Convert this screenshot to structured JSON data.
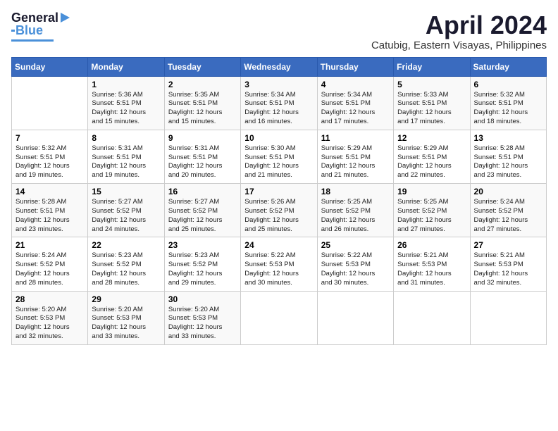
{
  "logo": {
    "line1": "General",
    "line2": "Blue"
  },
  "header": {
    "title": "April 2024",
    "location": "Catubig, Eastern Visayas, Philippines"
  },
  "weekdays": [
    "Sunday",
    "Monday",
    "Tuesday",
    "Wednesday",
    "Thursday",
    "Friday",
    "Saturday"
  ],
  "weeks": [
    [
      {
        "day": "",
        "content": ""
      },
      {
        "day": "1",
        "content": "Sunrise: 5:36 AM\nSunset: 5:51 PM\nDaylight: 12 hours\nand 15 minutes."
      },
      {
        "day": "2",
        "content": "Sunrise: 5:35 AM\nSunset: 5:51 PM\nDaylight: 12 hours\nand 15 minutes."
      },
      {
        "day": "3",
        "content": "Sunrise: 5:34 AM\nSunset: 5:51 PM\nDaylight: 12 hours\nand 16 minutes."
      },
      {
        "day": "4",
        "content": "Sunrise: 5:34 AM\nSunset: 5:51 PM\nDaylight: 12 hours\nand 17 minutes."
      },
      {
        "day": "5",
        "content": "Sunrise: 5:33 AM\nSunset: 5:51 PM\nDaylight: 12 hours\nand 17 minutes."
      },
      {
        "day": "6",
        "content": "Sunrise: 5:32 AM\nSunset: 5:51 PM\nDaylight: 12 hours\nand 18 minutes."
      }
    ],
    [
      {
        "day": "7",
        "content": "Sunrise: 5:32 AM\nSunset: 5:51 PM\nDaylight: 12 hours\nand 19 minutes."
      },
      {
        "day": "8",
        "content": "Sunrise: 5:31 AM\nSunset: 5:51 PM\nDaylight: 12 hours\nand 19 minutes."
      },
      {
        "day": "9",
        "content": "Sunrise: 5:31 AM\nSunset: 5:51 PM\nDaylight: 12 hours\nand 20 minutes."
      },
      {
        "day": "10",
        "content": "Sunrise: 5:30 AM\nSunset: 5:51 PM\nDaylight: 12 hours\nand 21 minutes."
      },
      {
        "day": "11",
        "content": "Sunrise: 5:29 AM\nSunset: 5:51 PM\nDaylight: 12 hours\nand 21 minutes."
      },
      {
        "day": "12",
        "content": "Sunrise: 5:29 AM\nSunset: 5:51 PM\nDaylight: 12 hours\nand 22 minutes."
      },
      {
        "day": "13",
        "content": "Sunrise: 5:28 AM\nSunset: 5:51 PM\nDaylight: 12 hours\nand 23 minutes."
      }
    ],
    [
      {
        "day": "14",
        "content": "Sunrise: 5:28 AM\nSunset: 5:51 PM\nDaylight: 12 hours\nand 23 minutes."
      },
      {
        "day": "15",
        "content": "Sunrise: 5:27 AM\nSunset: 5:52 PM\nDaylight: 12 hours\nand 24 minutes."
      },
      {
        "day": "16",
        "content": "Sunrise: 5:27 AM\nSunset: 5:52 PM\nDaylight: 12 hours\nand 25 minutes."
      },
      {
        "day": "17",
        "content": "Sunrise: 5:26 AM\nSunset: 5:52 PM\nDaylight: 12 hours\nand 25 minutes."
      },
      {
        "day": "18",
        "content": "Sunrise: 5:25 AM\nSunset: 5:52 PM\nDaylight: 12 hours\nand 26 minutes."
      },
      {
        "day": "19",
        "content": "Sunrise: 5:25 AM\nSunset: 5:52 PM\nDaylight: 12 hours\nand 27 minutes."
      },
      {
        "day": "20",
        "content": "Sunrise: 5:24 AM\nSunset: 5:52 PM\nDaylight: 12 hours\nand 27 minutes."
      }
    ],
    [
      {
        "day": "21",
        "content": "Sunrise: 5:24 AM\nSunset: 5:52 PM\nDaylight: 12 hours\nand 28 minutes."
      },
      {
        "day": "22",
        "content": "Sunrise: 5:23 AM\nSunset: 5:52 PM\nDaylight: 12 hours\nand 28 minutes."
      },
      {
        "day": "23",
        "content": "Sunrise: 5:23 AM\nSunset: 5:52 PM\nDaylight: 12 hours\nand 29 minutes."
      },
      {
        "day": "24",
        "content": "Sunrise: 5:22 AM\nSunset: 5:53 PM\nDaylight: 12 hours\nand 30 minutes."
      },
      {
        "day": "25",
        "content": "Sunrise: 5:22 AM\nSunset: 5:53 PM\nDaylight: 12 hours\nand 30 minutes."
      },
      {
        "day": "26",
        "content": "Sunrise: 5:21 AM\nSunset: 5:53 PM\nDaylight: 12 hours\nand 31 minutes."
      },
      {
        "day": "27",
        "content": "Sunrise: 5:21 AM\nSunset: 5:53 PM\nDaylight: 12 hours\nand 32 minutes."
      }
    ],
    [
      {
        "day": "28",
        "content": "Sunrise: 5:20 AM\nSunset: 5:53 PM\nDaylight: 12 hours\nand 32 minutes."
      },
      {
        "day": "29",
        "content": "Sunrise: 5:20 AM\nSunset: 5:53 PM\nDaylight: 12 hours\nand 33 minutes."
      },
      {
        "day": "30",
        "content": "Sunrise: 5:20 AM\nSunset: 5:53 PM\nDaylight: 12 hours\nand 33 minutes."
      },
      {
        "day": "",
        "content": ""
      },
      {
        "day": "",
        "content": ""
      },
      {
        "day": "",
        "content": ""
      },
      {
        "day": "",
        "content": ""
      }
    ]
  ]
}
